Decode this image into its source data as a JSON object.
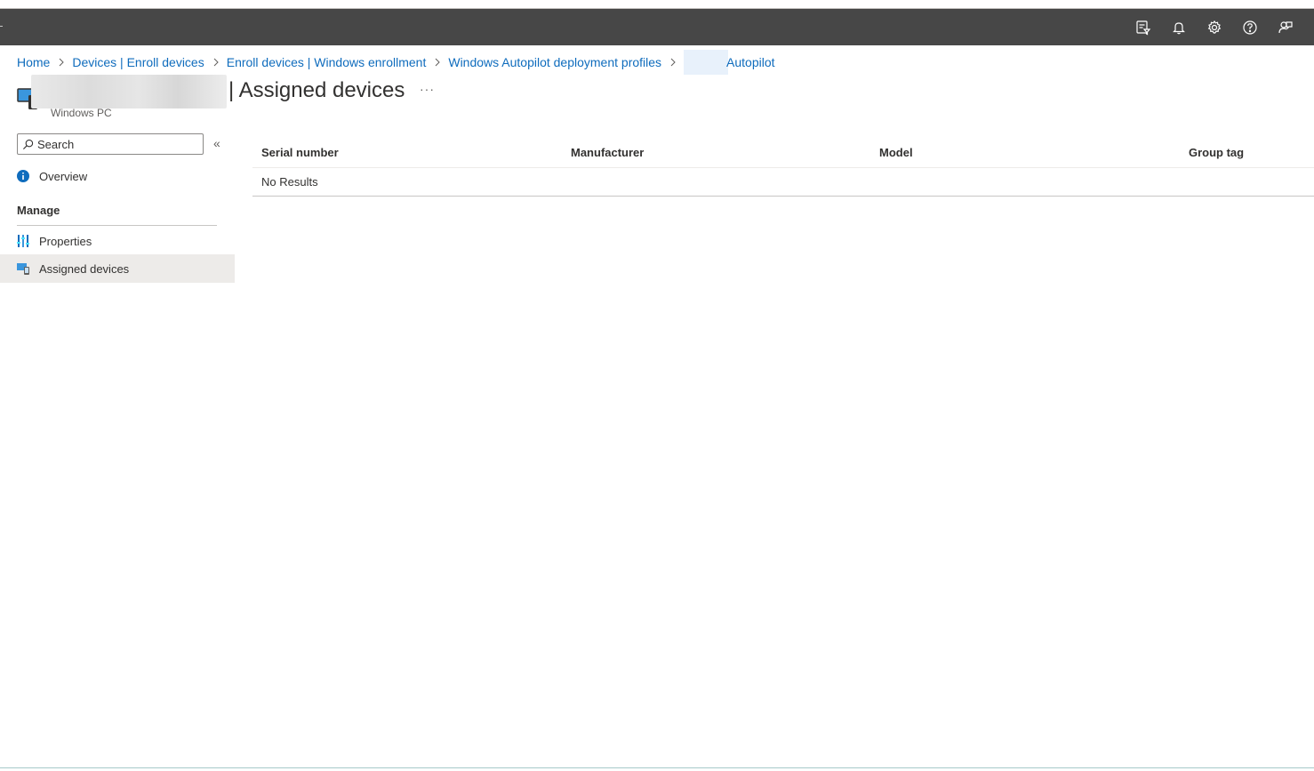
{
  "topbar": {
    "icons": [
      "portal-filter-icon",
      "bell-icon",
      "gear-icon",
      "help-icon",
      "feedback-icon"
    ]
  },
  "breadcrumb": {
    "items": [
      "Home",
      "Devices | Enroll devices",
      "Enroll devices | Windows enrollment",
      "Windows Autopilot deployment profiles",
      "Autopilot"
    ]
  },
  "header": {
    "title": "| Assigned devices",
    "subtitle": "Windows PC",
    "more": "···"
  },
  "sidebar": {
    "search_placeholder": "Search",
    "collapse": "«",
    "overview": "Overview",
    "section": "Manage",
    "items": [
      "Properties",
      "Assigned devices"
    ]
  },
  "table": {
    "columns": [
      "Serial number",
      "Manufacturer",
      "Model",
      "Group tag"
    ],
    "empty_text": "No Results"
  },
  "colors": {
    "topbar": "#474747",
    "link": "#0f6cbd",
    "active_nav": "#edebe9"
  }
}
